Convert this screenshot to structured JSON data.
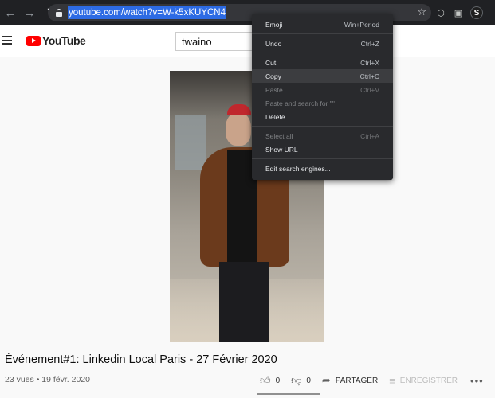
{
  "browser": {
    "back_icon": "arrow-left-icon",
    "forward_icon": "arrow-right-icon",
    "reload_icon": "reload-icon",
    "url": "youtube.com/watch?v=W-k5xKUYCN4",
    "avatar_letter": "S"
  },
  "youtube": {
    "logo_text": "YouTube",
    "search_value": "twaino",
    "video_title": "Événement#1: Linkedin Local Paris - 27 Février 2020",
    "views_date": "23 vues • 19 févr. 2020",
    "likes": "0",
    "dislikes": "0",
    "share_label": "PARTAGER",
    "save_label": "ENREGISTRER",
    "more_label": "•••"
  },
  "context_menu": {
    "items": [
      {
        "label": "Emoji",
        "shortcut": "Win+Period",
        "disabled": false
      },
      {
        "label": "Undo",
        "shortcut": "Ctrl+Z",
        "disabled": false
      },
      {
        "label": "Cut",
        "shortcut": "Ctrl+X",
        "disabled": false
      },
      {
        "label": "Copy",
        "shortcut": "Ctrl+C",
        "disabled": false,
        "highlighted": true
      },
      {
        "label": "Paste",
        "shortcut": "Ctrl+V",
        "disabled": true
      },
      {
        "label": "Paste and search for \"\"",
        "shortcut": "",
        "disabled": true
      },
      {
        "label": "Delete",
        "shortcut": "",
        "disabled": false
      },
      {
        "label": "Select all",
        "shortcut": "Ctrl+A",
        "disabled": true
      },
      {
        "label": "Show URL",
        "shortcut": "",
        "disabled": false
      },
      {
        "label": "Edit search engines...",
        "shortcut": "",
        "disabled": false
      }
    ]
  },
  "colors": {
    "browser_bg": "#202124",
    "url_selection": "#2d6be4",
    "youtube_red": "#ff0000",
    "menu_bg": "#292a2d"
  }
}
